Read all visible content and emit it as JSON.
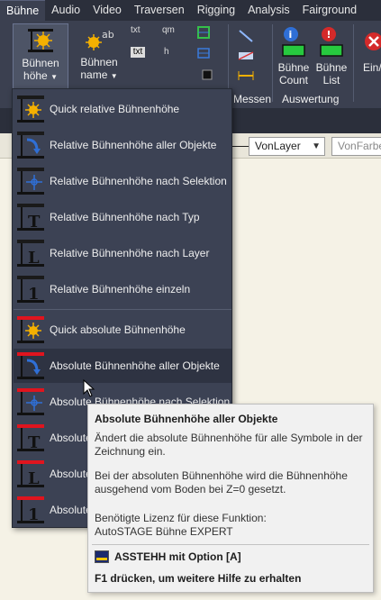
{
  "tabs": [
    "Bühne",
    "Audio",
    "Video",
    "Traversen",
    "Rigging",
    "Analysis",
    "Fairground"
  ],
  "ribbon": {
    "buehnen_hoehe": {
      "line1": "Bühnen",
      "line2": "höhe"
    },
    "buehnen_name": {
      "line1": "Bühnen",
      "line2": "name"
    },
    "small_labels": {
      "txt1": "txt",
      "txt2": "txt",
      "qm": "qm",
      "h": "h"
    },
    "messen_label": "Messen",
    "auswertung_label": "Auswertung",
    "buehne_count": {
      "line1": "Bühne",
      "line2": "Count"
    },
    "buehne_list": {
      "line1": "Bühne",
      "line2": "List"
    },
    "ein_aus": "Ein/"
  },
  "props": {
    "layer_combo": "VonLayer",
    "color_combo": "VonFarbe"
  },
  "menu": {
    "items": [
      {
        "label": "Quick relative Bühnenhöhe",
        "icon": "quick-relative-height-icon",
        "hover": false
      },
      {
        "label": "Relative Bühnenhöhe aller Objekte",
        "icon": "relative-height-all-icon",
        "hover": false
      },
      {
        "label": "Relative Bühnenhöhe nach Selektion",
        "icon": "relative-height-selection-icon",
        "hover": false
      },
      {
        "label": "Relative Bühnenhöhe nach Typ",
        "icon": "relative-height-type-icon",
        "hover": false
      },
      {
        "label": "Relative Bühnenhöhe nach Layer",
        "icon": "relative-height-layer-icon",
        "hover": false
      },
      {
        "label": "Relative Bühnenhöhe einzeln",
        "icon": "relative-height-single-icon",
        "hover": false
      },
      {
        "label": "Quick absolute Bühnenhöhe",
        "icon": "quick-absolute-height-icon",
        "hover": false
      },
      {
        "label": "Absolute Bühnenhöhe aller Objekte",
        "icon": "absolute-height-all-icon",
        "hover": true
      },
      {
        "label": "Absolute Bühnenhöhe nach Selektion",
        "icon": "absolute-height-selection-icon",
        "hover": false
      },
      {
        "label": "Absolute Bühnenhöhe nach Typ",
        "icon": "absolute-height-type-icon",
        "hover": false
      },
      {
        "label": "Absolute Bühnenhöhe nach Layer",
        "icon": "absolute-height-layer-icon",
        "hover": false
      },
      {
        "label": "Absolute Bühnenhöhe einzeln",
        "icon": "absolute-height-single-icon",
        "hover": false
      }
    ]
  },
  "tooltip": {
    "title": "Absolute Bühnenhöhe aller Objekte",
    "desc": "Ändert die absolute Bühnenhöhe für alle Symbole in der Zeichnung ein.",
    "desc2": "Bei der absoluten Bühnenhöhe wird die Bühnenhöhe ausgehend vom Boden bei Z=0 gesetzt.",
    "license_label": "Benötigte Lizenz für diese Funktion:",
    "license_value": "AutoSTAGE Bühne EXPERT",
    "command": "ASSTEHH mit Option [A]",
    "help": "F1 drücken, um weitere Hilfe zu erhalten"
  },
  "colors": {
    "relative_bar": "#1a1a1a",
    "absolute_bar": "#e0141e",
    "accent_blue": "#2f6fd6",
    "accent_green": "#27c93f"
  }
}
